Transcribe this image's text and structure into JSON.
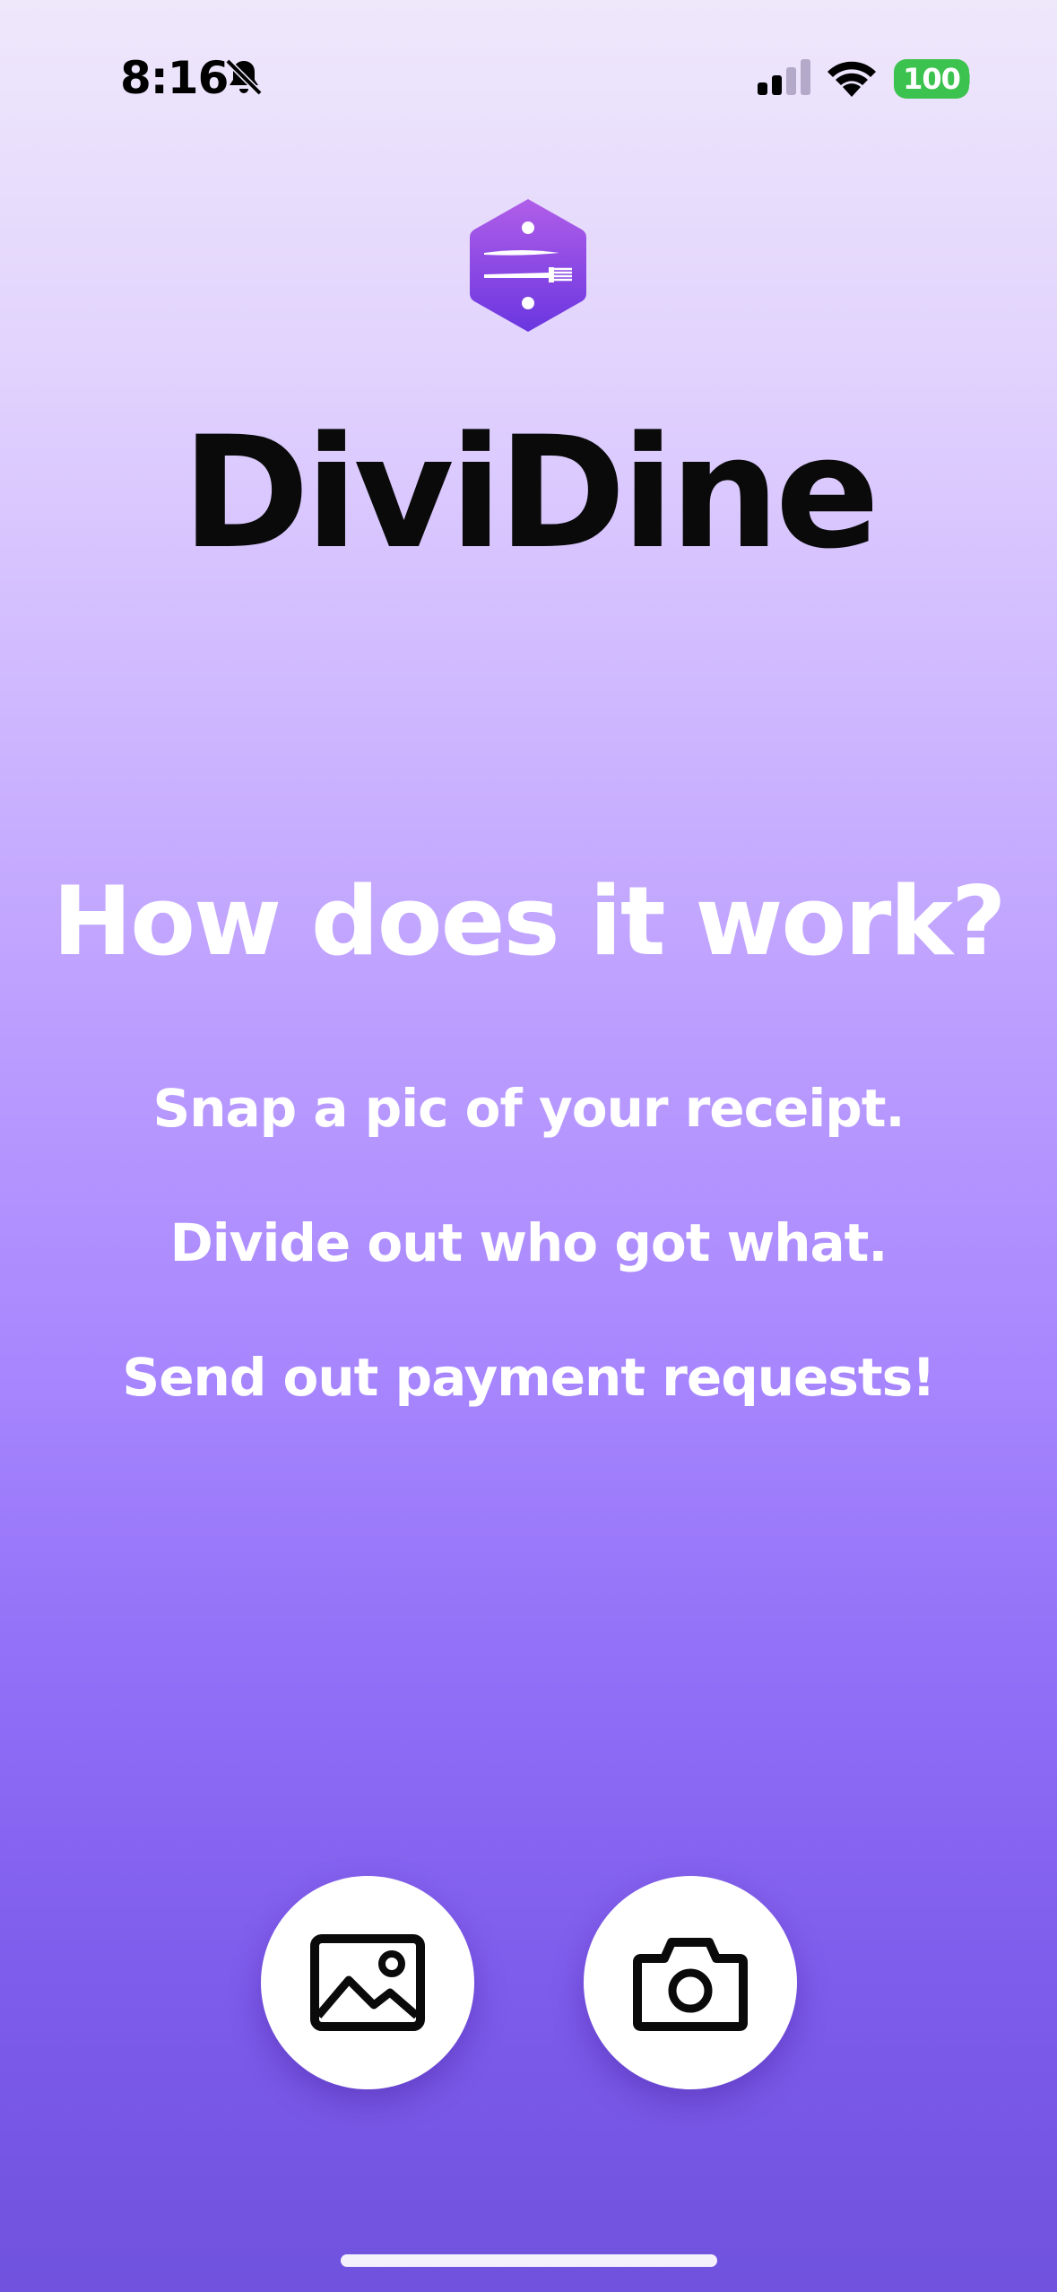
{
  "status_bar": {
    "time": "8:16",
    "battery": "100",
    "icons": [
      "bell-slash-icon",
      "cellular-signal-icon",
      "wifi-icon",
      "battery-icon"
    ]
  },
  "app": {
    "logo_icon": "knife-fork-hexagon-logo",
    "name": "DiviDine"
  },
  "how_it_works": {
    "title": "How does it work?",
    "steps": [
      "Snap a pic of your receipt.",
      "Divide out who got what.",
      "Send out payment requests!"
    ]
  },
  "actions": {
    "gallery_icon": "photo-gallery-icon",
    "camera_icon": "camera-icon"
  },
  "colors": {
    "gradient_top": "#EFE8FB",
    "gradient_bottom": "#6F52DD",
    "logo_purple": "#8A4FE8",
    "battery_green": "#3CC24E"
  }
}
